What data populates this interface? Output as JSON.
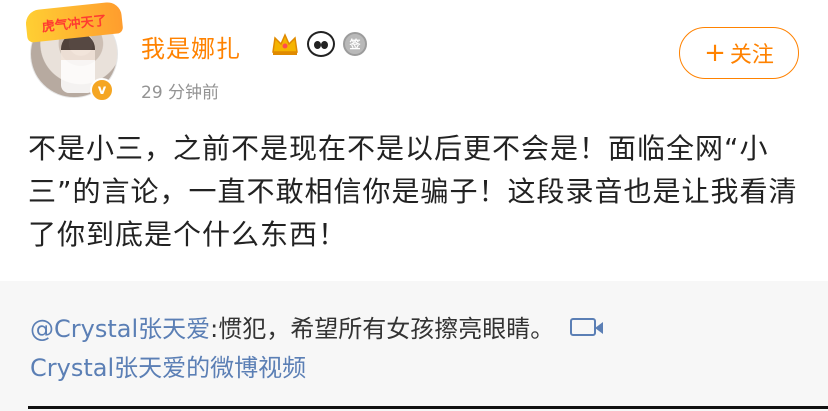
{
  "post": {
    "avatar_frame_text": "虎气冲天了",
    "verified_mark": "v",
    "username": "我是娜扎",
    "badges": {
      "crown": "crown-icon",
      "panda": "panda-icon",
      "medal": "medal-icon",
      "medal_text": "签"
    },
    "timestamp": "29 分钟前",
    "follow_plus": "+",
    "follow_label": "关注",
    "content": "不是小三，之前不是现在不是以后更不会是！面临全网“小三”的言论，一直不敢相信你是骗子！这段录音也是让我看清了你到底是个什么东西！"
  },
  "repost": {
    "mention": "@Crystal张天爱",
    "text": ":惯犯，希望所有女孩擦亮眼睛。",
    "video_link": "Crystal张天爱的微博视频"
  },
  "colors": {
    "accent": "#ff8200",
    "link": "#5b7fb5",
    "text": "#222222",
    "muted": "#939393",
    "repost_bg": "#f7f7f7"
  }
}
